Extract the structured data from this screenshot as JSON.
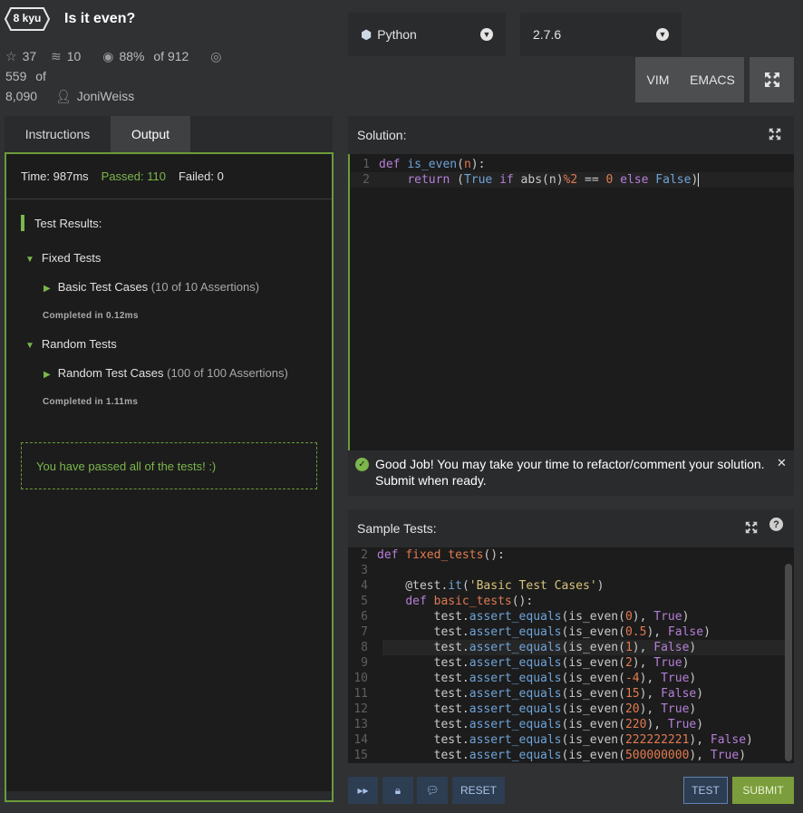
{
  "header": {
    "kyu": "8 kyu",
    "title": "Is it even?",
    "stars": "37",
    "collections": "10",
    "satisfaction": "88%",
    "votes_of": "of 912",
    "completed": "559",
    "completed_of": "of",
    "completed_total": "8,090",
    "author": "JoniWeiss"
  },
  "toolbar": {
    "language": "Python",
    "version": "2.7.6",
    "vim_label": "VIM",
    "emacs_label": "EMACS"
  },
  "left_tabs": {
    "instructions": "Instructions",
    "output": "Output"
  },
  "output": {
    "time": "Time: 987ms",
    "passed": "Passed: 110",
    "failed": "Failed: 0",
    "results_title": "Test Results:",
    "groups": [
      {
        "name": "Fixed Tests",
        "case": "Basic Test Cases",
        "assertions": "(10 of 10 Assertions)",
        "completed": "Completed in 0.12ms"
      },
      {
        "name": "Random Tests",
        "case": "Random Test Cases",
        "assertions": "(100 of 100 Assertions)",
        "completed": "Completed in 1.11ms"
      }
    ],
    "pass_message": "You have passed all of the tests! :)"
  },
  "solution": {
    "title": "Solution:",
    "line_numbers": [
      "1",
      "2"
    ]
  },
  "message": {
    "text": "Good Job! You may take your time to refactor/comment your solution. Submit when ready."
  },
  "sample": {
    "title": "Sample Tests:",
    "line_numbers": [
      "2",
      "3",
      "4",
      "5",
      "6",
      "7",
      "8",
      "9",
      "10",
      "11",
      "12",
      "13",
      "14",
      "15"
    ]
  },
  "bottom": {
    "reset_label": "RESET",
    "test_label": "TEST",
    "submit_label": "SUBMIT"
  }
}
